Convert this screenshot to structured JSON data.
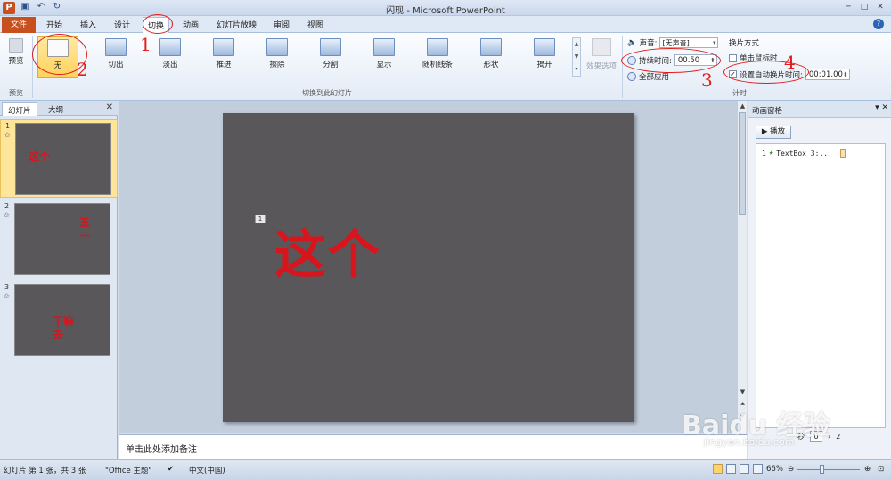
{
  "window": {
    "title": "闪现 - Microsoft PowerPoint",
    "app_icon": "P",
    "controls": [
      "─",
      "□",
      "✕"
    ]
  },
  "qat": [
    "save-icon",
    "undo-icon",
    "redo-icon"
  ],
  "tabs": {
    "file": "文件",
    "items": [
      "开始",
      "插入",
      "设计",
      "切换",
      "动画",
      "幻灯片放映",
      "审阅",
      "视图"
    ],
    "active": "切换"
  },
  "ribbon": {
    "preview": {
      "label": "预览",
      "group": "预览"
    },
    "transitions": [
      "无",
      "切出",
      "淡出",
      "推进",
      "擦除",
      "分割",
      "显示",
      "随机线条",
      "形状",
      "揭开"
    ],
    "selected_transition": "无",
    "effect_options": "效果选项",
    "group_transition_label": "切换到此幻灯片",
    "sound_label": "声音:",
    "sound_value": "[无声音]",
    "duration_label": "持续时间:",
    "duration_value": "00.50",
    "apply_all": "全部应用",
    "advance_header": "换片方式",
    "on_click": "单击鼠标时",
    "on_click_checked": false,
    "auto_after": "设置自动换片时间:",
    "auto_after_checked": true,
    "auto_after_value": "00:01.00",
    "timing_group": "计时"
  },
  "left_pane": {
    "tabs": [
      "幻灯片",
      "大纲"
    ],
    "close": "✕",
    "slides": [
      {
        "num": "1",
        "text": "这个"
      },
      {
        "num": "2",
        "text": "五一"
      },
      {
        "num": "3",
        "text": "干嘛去"
      }
    ]
  },
  "slide": {
    "anim_tag": "1",
    "text": "这个"
  },
  "notes": {
    "placeholder": "单击此处添加备注"
  },
  "anim_pane": {
    "title": "动画窗格",
    "play": "播放",
    "items": [
      {
        "index": "1",
        "name": "TextBox 3:..."
      }
    ],
    "bottom_label": "秒",
    "bottom_from": "0",
    "bottom_to": "2"
  },
  "status": {
    "slide_info": "幻灯片 第 1 张，共 3 张",
    "theme": "\"Office 主题\"",
    "language": "中文(中国)",
    "zoom": "66%"
  },
  "annotations": [
    "1",
    "2",
    "3",
    "4"
  ],
  "watermark": {
    "text": "Baidu 经验",
    "url": "jingyan.baidu.com"
  },
  "colors": {
    "file_tab": "#c8501e",
    "slide_bg": "#5a575a",
    "slide_text": "#d8141c",
    "selected_gallery": "#ffd35a",
    "annotation": "#e21b1b"
  }
}
